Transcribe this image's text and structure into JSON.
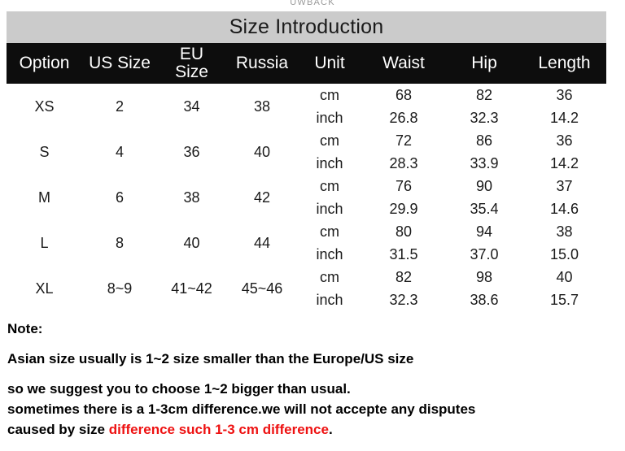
{
  "watermark": {
    "text": "UWBACK"
  },
  "table": {
    "title": "Size Introduction",
    "headers": [
      "Option",
      "US Size",
      "EU\nSize",
      "Russia",
      "Unit",
      "Waist",
      "Hip",
      "Length"
    ],
    "header_labels": {
      "option": "Option",
      "us_size": "US Size",
      "eu_size_line1": "EU",
      "eu_size_line2": "Size",
      "russia": "Russia",
      "unit": "Unit",
      "waist": "Waist",
      "hip": "Hip",
      "length": "Length"
    },
    "units": {
      "cm": "cm",
      "inch": "inch"
    },
    "rows": [
      {
        "option": "XS",
        "us_size": "2",
        "eu_size": "34",
        "russia": "38",
        "cm": {
          "unit": "cm",
          "waist": "68",
          "hip": "82",
          "length": "36"
        },
        "inch": {
          "unit": "inch",
          "waist": "26.8",
          "hip": "32.3",
          "length": "14.2"
        }
      },
      {
        "option": "S",
        "us_size": "4",
        "eu_size": "36",
        "russia": "40",
        "cm": {
          "unit": "cm",
          "waist": "72",
          "hip": "86",
          "length": "36"
        },
        "inch": {
          "unit": "inch",
          "waist": "28.3",
          "hip": "33.9",
          "length": "14.2"
        }
      },
      {
        "option": "M",
        "us_size": "6",
        "eu_size": "38",
        "russia": "42",
        "cm": {
          "unit": "cm",
          "waist": "76",
          "hip": "90",
          "length": "37"
        },
        "inch": {
          "unit": "inch",
          "waist": "29.9",
          "hip": "35.4",
          "length": "14.6"
        }
      },
      {
        "option": "L",
        "us_size": "8",
        "eu_size": "40",
        "russia": "44",
        "cm": {
          "unit": "cm",
          "waist": "80",
          "hip": "94",
          "length": "38"
        },
        "inch": {
          "unit": "inch",
          "waist": "31.5",
          "hip": "37.0",
          "length": "15.0"
        }
      },
      {
        "option": "XL",
        "us_size": "8~9",
        "eu_size": "41~42",
        "russia": "45~46",
        "cm": {
          "unit": "cm",
          "waist": "82",
          "hip": "98",
          "length": "40"
        },
        "inch": {
          "unit": "inch",
          "waist": "32.3",
          "hip": "38.6",
          "length": "15.7"
        }
      }
    ]
  },
  "note": {
    "heading": "Note:",
    "line1": "Asian size usually is 1~2 size smaller than the Europe/US size",
    "line2": "so we suggest you to choose 1~2 bigger than usual.",
    "line3": "sometimes there is a 1-3cm difference.we will not accepte any disputes",
    "line4_black": "caused by size ",
    "line4_red": "difference such 1-3 cm difference",
    "line4_end": "."
  },
  "colors": {
    "title_background": "#cbcbcb",
    "header_background": "#0d0d0d",
    "header_text": "#ffffff",
    "band_background": "#cfcfcf",
    "body_text": "#1a1a1a",
    "note_red": "#ee1111",
    "page_background": "#ffffff"
  }
}
